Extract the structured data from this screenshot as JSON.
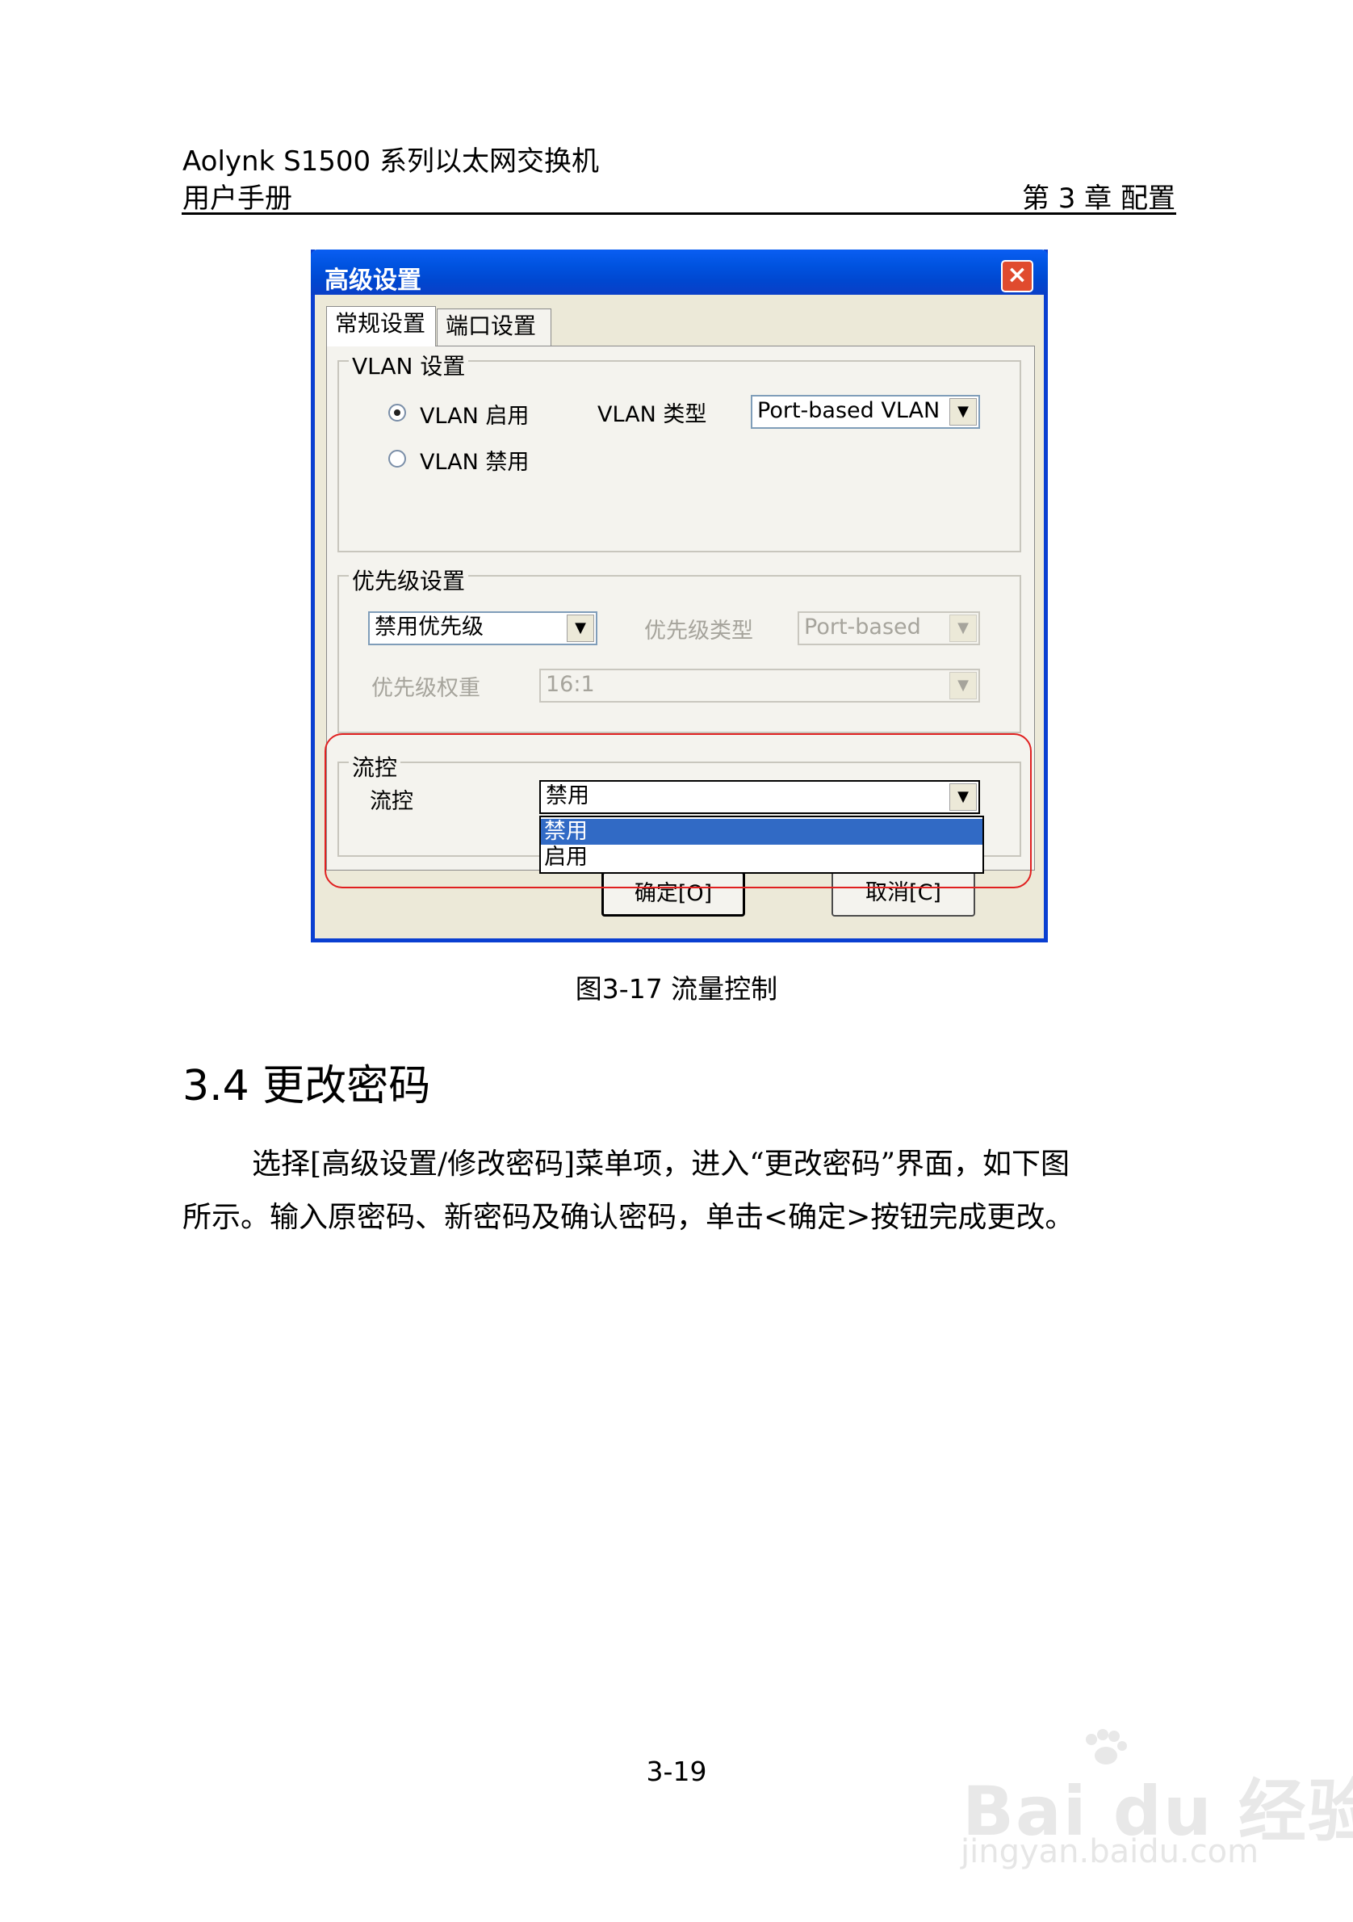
{
  "header": {
    "line1": "Aolynk S1500 系列以太网交换机",
    "line2": "用户手册",
    "chapter": "第 3 章  配置"
  },
  "dialog": {
    "title": "高级设置",
    "close_label": "×",
    "tabs": [
      {
        "label": "常规设置",
        "active": true
      },
      {
        "label": "端口设置",
        "active": false
      }
    ],
    "vlan_group": {
      "legend": "VLAN 设置",
      "radio_enable": "VLAN 启用",
      "radio_disable": "VLAN 禁用",
      "selected": "VLAN 启用",
      "type_label": "VLAN 类型",
      "type_value": "Port-based VLAN"
    },
    "priority_group": {
      "legend": "优先级设置",
      "priority_value": "禁用优先级",
      "type_label": "优先级类型",
      "type_value": "Port-based",
      "weight_label": "优先级权重",
      "weight_value": "16:1"
    },
    "flow_group": {
      "legend": "流控",
      "label": "流控",
      "value": "禁用",
      "options": [
        "禁用",
        "启用"
      ],
      "highlighted_option": "禁用"
    },
    "ok_button": "确定[O]",
    "cancel_button": "取消[C]"
  },
  "caption": "图3-17  流量控制",
  "section_title": "3.4  更改密码",
  "body": {
    "p1": "选择[高级设置/修改密码]菜单项，进入“更改密码”界面，如下图",
    "p2": "所示。输入原密码、新密码及确认密码，单击<确定>按钮完成更改。"
  },
  "page_number": "3-19",
  "watermark": {
    "logo": "Bai du 经验",
    "url": "jingyan.baidu.com"
  },
  "colors": {
    "titlebar": "#0054e3",
    "highlight_ring": "#e02020",
    "dropdown_selection": "#316ac5"
  }
}
